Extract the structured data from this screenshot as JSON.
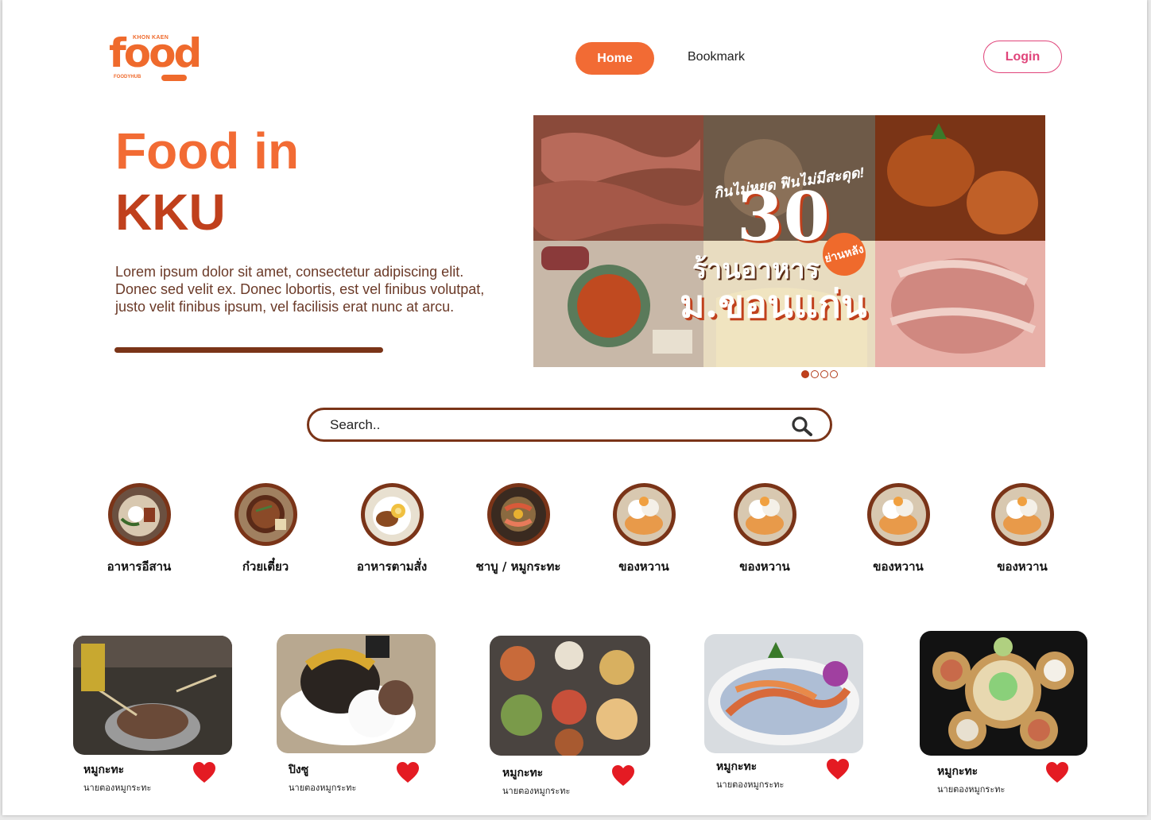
{
  "brand": {
    "top_text": "KHON KAEN",
    "word": "food",
    "foot_left": "FOODYHUB"
  },
  "nav": {
    "home": "Home",
    "bookmark": "Bookmark",
    "login": "Login"
  },
  "hero": {
    "title_line1": "Food in",
    "title_line2": "KKU",
    "description": "Lorem ipsum dolor sit amet, consectetur adipiscing elit. Donec sed velit ex. Donec lobortis, est vel finibus volutpat, justo velit finibus ipsum, vel facilisis erat nunc at arcu."
  },
  "banner": {
    "tagline": "กินไม่หยุด ฟินไม่มีสะดุด!",
    "number": "30",
    "badge": "ย่านหลัง",
    "line1": "ร้านอาหาร",
    "line2": "ม.ขอนแก่น",
    "slides": 4,
    "active_slide": 1
  },
  "search": {
    "placeholder": "Search.."
  },
  "categories": [
    {
      "label": "อาหารอีสาน"
    },
    {
      "label": "ก๋วยเตี๋ยว"
    },
    {
      "label": "อาหารตามสั่ง"
    },
    {
      "label": "ชาบู / หมูกระทะ"
    },
    {
      "label": "ของหวาน"
    },
    {
      "label": "ของหวาน"
    },
    {
      "label": "ของหวาน"
    },
    {
      "label": "ของหวาน"
    }
  ],
  "cards": [
    {
      "name": "หมูกะทะ",
      "sub": "นายตองหมูกระทะ"
    },
    {
      "name": "ปิงซู",
      "sub": "นายตองหมูกระทะ"
    },
    {
      "name": "หมูกะทะ",
      "sub": "นายตองหมูกระทะ"
    },
    {
      "name": "หมูกะทะ",
      "sub": "นายตองหมูกระทะ"
    },
    {
      "name": "หมูกะทะ",
      "sub": "นายตองหมูกระทะ"
    }
  ],
  "colors": {
    "accent": "#f26b34",
    "brown": "#7a3418",
    "login": "#e0447a",
    "heart": "#e41b23"
  }
}
